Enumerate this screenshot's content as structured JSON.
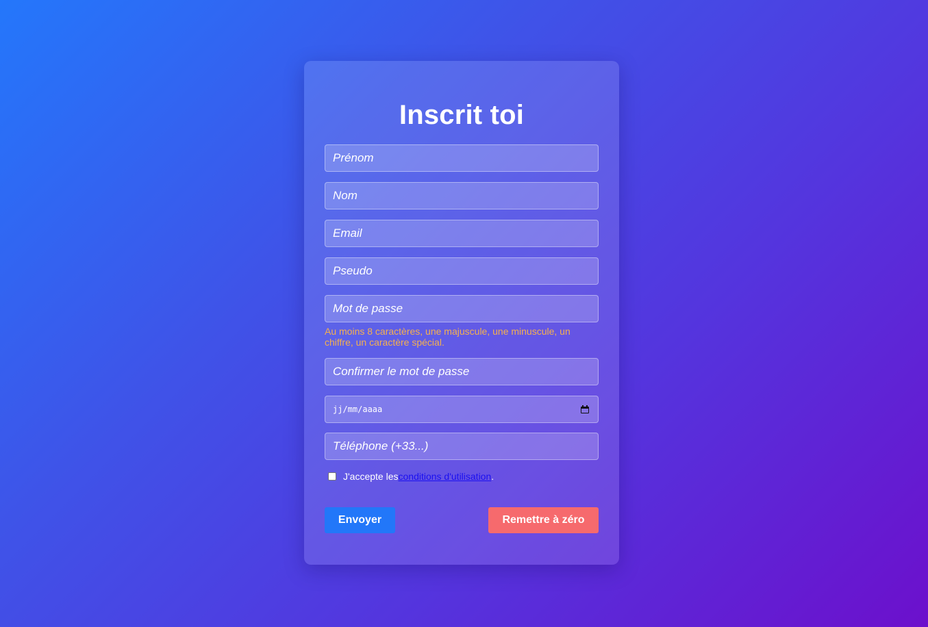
{
  "form": {
    "title": "Inscrit toi",
    "fields": {
      "first_name": {
        "placeholder": "Prénom",
        "value": ""
      },
      "last_name": {
        "placeholder": "Nom",
        "value": ""
      },
      "email": {
        "placeholder": "Email",
        "value": ""
      },
      "username": {
        "placeholder": "Pseudo",
        "value": ""
      },
      "password": {
        "placeholder": "Mot de passe",
        "value": ""
      },
      "password_confirm": {
        "placeholder": "Confirmer le mot de passe",
        "value": ""
      },
      "birth_date": {
        "placeholder": "jj/mm/aaaa",
        "value": ""
      },
      "phone": {
        "placeholder": "Téléphone (+33...)",
        "value": ""
      }
    },
    "password_hint": "Au moins 8 caractères, une majuscule, une minuscule, un chiffre, un caractère spécial.",
    "terms": {
      "checked": false,
      "prefix": "J'accepte les",
      "link_label": "conditions d'utilisation",
      "suffix": "."
    },
    "buttons": {
      "submit_label": "Envoyer",
      "reset_label": "Remettre à zéro"
    }
  },
  "icons": {
    "date_picker": "calendar-icon"
  },
  "colors": {
    "background_start": "#2477fb",
    "background_end": "#6c10cc",
    "hint": "#f5b04f",
    "submit": "#2277f9",
    "reset": "#f66a6d",
    "link": "#1a10f0"
  }
}
